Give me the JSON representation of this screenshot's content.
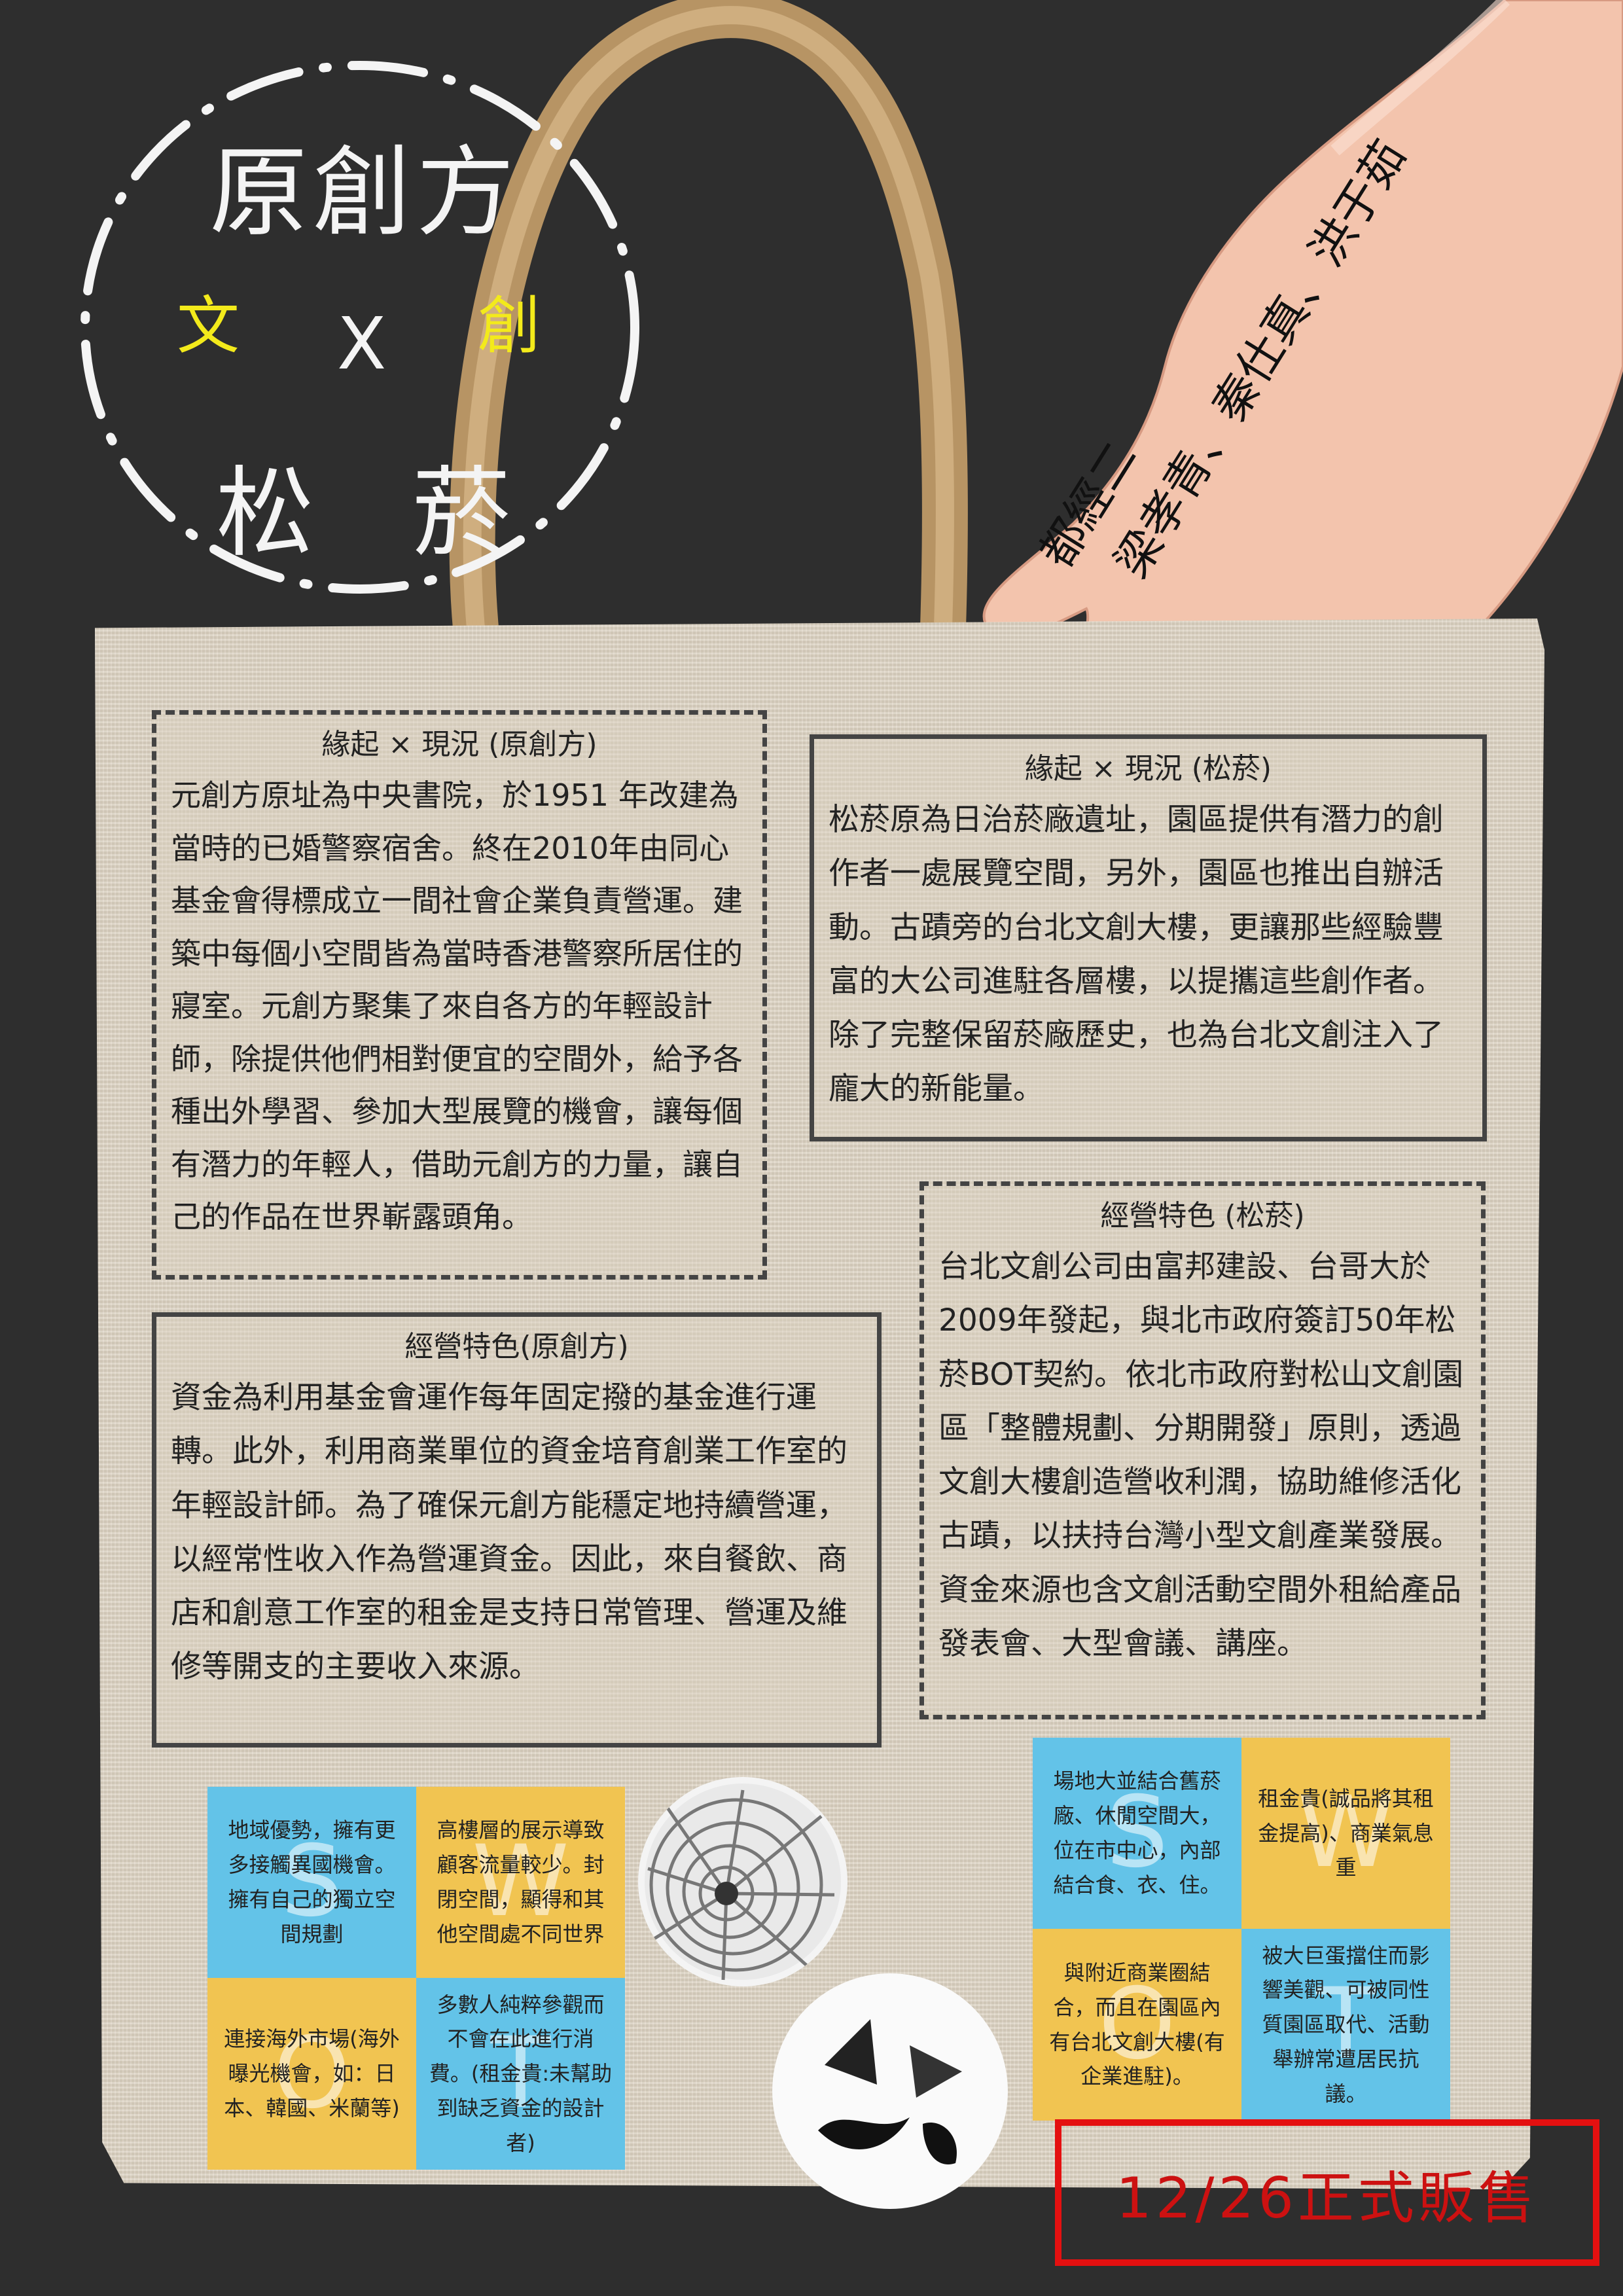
{
  "title": {
    "line1": "原創方",
    "left_char": "文",
    "cross": "X",
    "right_char": "創",
    "line3_a": "松",
    "line3_b": "菸"
  },
  "authors": {
    "line1": "都經二",
    "line2": "梁孝青、秦仕真、洪于茹"
  },
  "sections": {
    "origin_yuan": {
      "heading": "緣起 × 現況 (原創方)",
      "body": "元創方原址為中央書院，於1951 年改建為當時的已婚警察宿舍。終在2010年由同心基金會得標成立一間社會企業負責營運。建築中每個小空間皆為當時香港警察所居住的寢室。元創方聚集了來自各方的年輕設計師，除提供他們相對便宜的空間外，給予各種出外學習、參加大型展覽的機會，讓每個有潛力的年輕人，借助元創方的力量，讓自己的作品在世界嶄露頭角。"
    },
    "origin_song": {
      "heading": "緣起 × 現況 (松菸)",
      "body": "松菸原為日治菸廠遺址，園區提供有潛力的創作者一處展覽空間，另外，園區也推出自辦活動。古蹟旁的台北文創大樓，更讓那些經驗豐富的大公司進駐各層樓，以提攜這些創作者。除了完整保留菸廠歷史，也為台北文創注入了龐大的新能量。"
    },
    "biz_song": {
      "heading": "經營特色 (松菸)",
      "body": "台北文創公司由富邦建設、台哥大於2009年發起，與北市政府簽訂50年松菸BOT契約。依北市政府對松山文創園區「整體規劃、分期開發」原則，透過文創大樓創造營收利潤，協助維修活化古蹟，以扶持台灣小型文創產業發展。資金來源也含文創活動空間外租給產品發表會、大型會議、講座。"
    },
    "biz_yuan": {
      "heading": "經營特色(原創方)",
      "body": "資金為利用基金會運作每年固定撥的基金進行運轉。此外，利用商業單位的資金培育創業工作室的年輕設計師。為了確保元創方能穩定地持續營運，以經常性收入作為營運資金。因此，來自餐飲、商店和創意工作室的租金是支持日常管理、營運及維修等開支的主要收入來源。"
    }
  },
  "swot_yuan": {
    "s": {
      "letter": "S",
      "text": "地域優勢，擁有更多接觸異國機會。擁有自己的獨立空間規劃"
    },
    "w": {
      "letter": "W",
      "text": "高樓層的展示導致顧客流量較少。封閉空間，顯得和其他空間處不同世界"
    },
    "o": {
      "letter": "O",
      "text": "連接海外市場(海外曝光機會，如：日本、韓國、米蘭等)"
    },
    "t": {
      "letter": "T",
      "text": "多數人純粹參觀而不會在此進行消費。(租金貴:未幫助到缺乏資金的設計者)"
    }
  },
  "swot_song": {
    "s": {
      "letter": "S",
      "text": "場地大並結合舊菸廠、休閒空間大，位在市中心，內部結合食、衣、住。"
    },
    "w": {
      "letter": "W",
      "text": "租金貴(誠品將其租金提高)、商業氣息重"
    },
    "o": {
      "letter": "O",
      "text": "與附近商業圈結合，而且在園區內有台北文創大樓(有企業進駐)。"
    },
    "t": {
      "letter": "T",
      "text": "被大巨蛋擋住而影響美觀、可被同性質園區取代、活動舉辦常遭居民抗議。"
    }
  },
  "sale": {
    "text": "12/26正式販售"
  },
  "colors": {
    "background": "#2e2e2e",
    "accent_yellow": "#f3ea1b",
    "swot_blue": "#63c3e8",
    "swot_gold": "#f1c451",
    "sale_red": "#e41010"
  }
}
